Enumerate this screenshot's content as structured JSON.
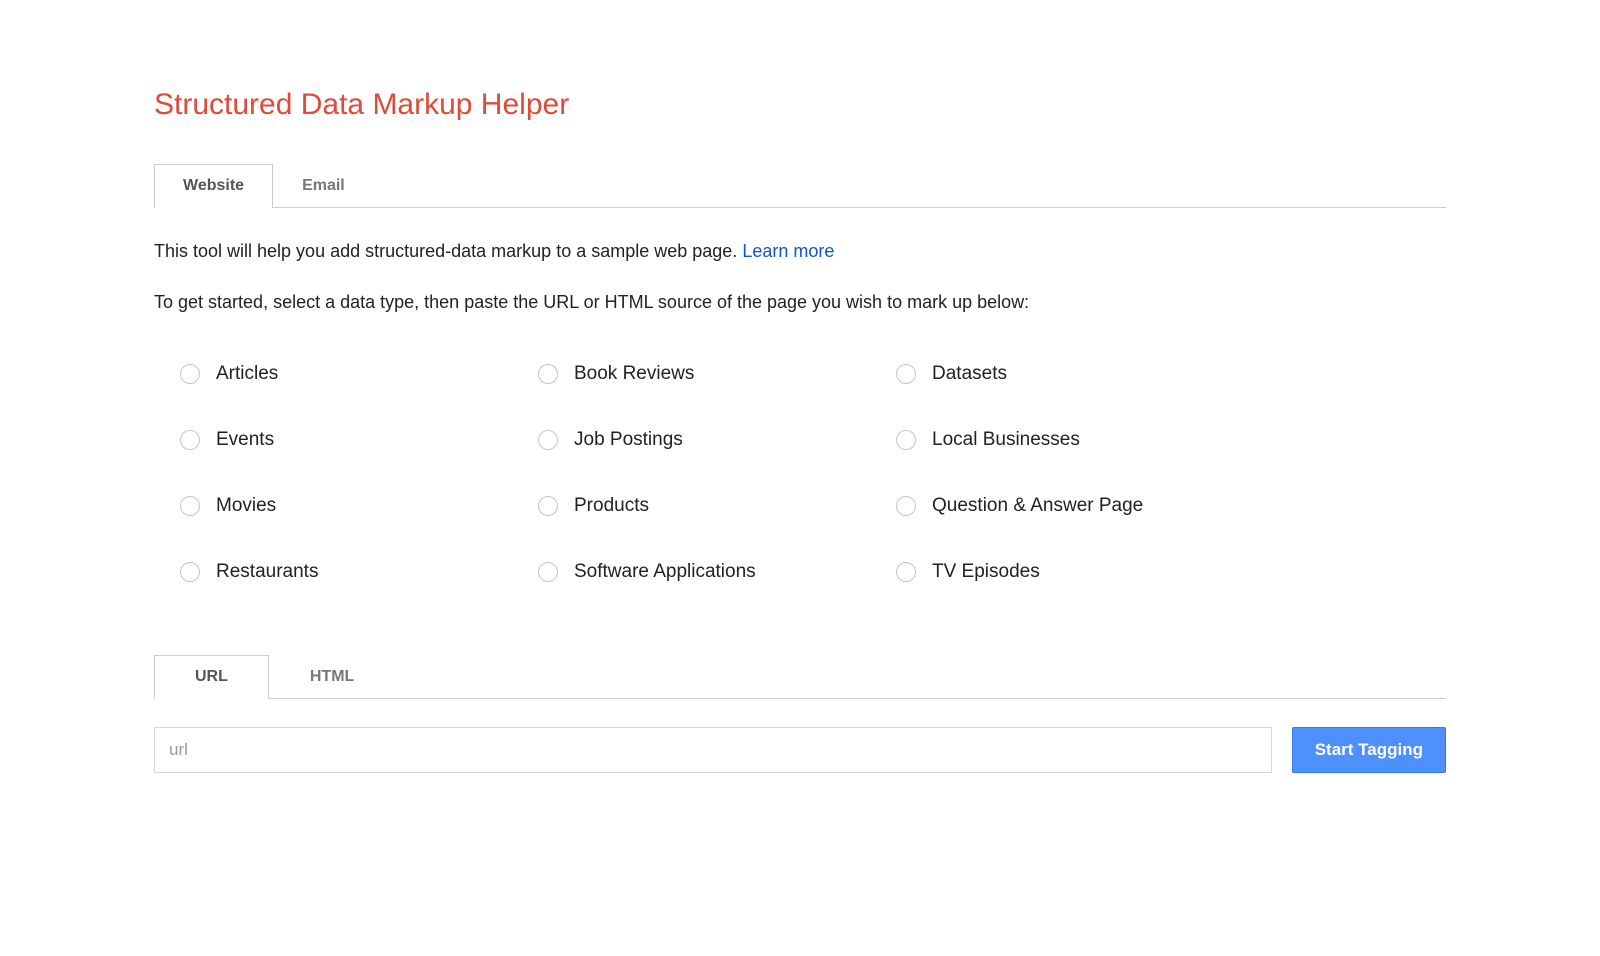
{
  "title": "Structured Data Markup Helper",
  "top_tabs": {
    "website": "Website",
    "email": "Email"
  },
  "intro_text": "This tool will help you add structured-data markup to a sample web page. ",
  "learn_more": "Learn more",
  "instructions": "To get started, select a data type, then paste the URL or HTML source of the page you wish to mark up below:",
  "data_types": {
    "articles": "Articles",
    "book_reviews": "Book Reviews",
    "datasets": "Datasets",
    "events": "Events",
    "job_postings": "Job Postings",
    "local_businesses": "Local Businesses",
    "movies": "Movies",
    "products": "Products",
    "qa_page": "Question & Answer Page",
    "restaurants": "Restaurants",
    "software_apps": "Software Applications",
    "tv_episodes": "TV Episodes"
  },
  "input_tabs": {
    "url": "URL",
    "html": "HTML"
  },
  "url_placeholder": "url",
  "start_button": "Start Tagging"
}
